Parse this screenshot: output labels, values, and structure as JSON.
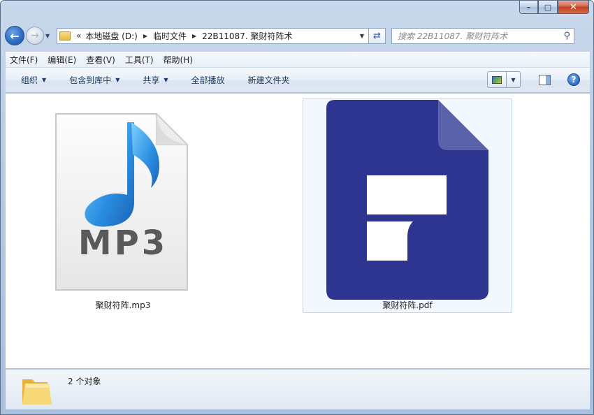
{
  "window": {
    "caption_buttons": {
      "minimize": "–",
      "maximize": "□",
      "close": "✕"
    }
  },
  "nav": {
    "back_icon": "arrow-left-icon",
    "forward_icon": "arrow-right-icon",
    "breadcrumb_overflow": "«",
    "breadcrumb": [
      "本地磁盘 (D:)",
      "临时文件",
      "22B11087. 聚财符阵术"
    ],
    "search_placeholder": "搜索 22B11087. 聚财符阵术"
  },
  "menu": {
    "items": [
      "文件(F)",
      "编辑(E)",
      "查看(V)",
      "工具(T)",
      "帮助(H)"
    ]
  },
  "toolbar": {
    "organize": "组织",
    "include_in_library": "包含到库中",
    "share": "共享",
    "play_all": "全部播放",
    "new_folder": "新建文件夹",
    "help_label": "?"
  },
  "files": [
    {
      "name": "聚财符阵.mp3",
      "type": "mp3",
      "icon_text": "MP3",
      "icon": "mp3-file-icon"
    },
    {
      "name": "聚财符阵.pdf",
      "type": "pdf",
      "icon": "pdf-file-icon",
      "selected": true
    }
  ],
  "status": {
    "count_text": "2 个对象"
  },
  "colors": {
    "pdf_blue": "#2d3590",
    "pdf_fold": "#5b62aa",
    "music_note_blue": "#2a8ee0",
    "selection_bg": "#f2f8fd"
  }
}
